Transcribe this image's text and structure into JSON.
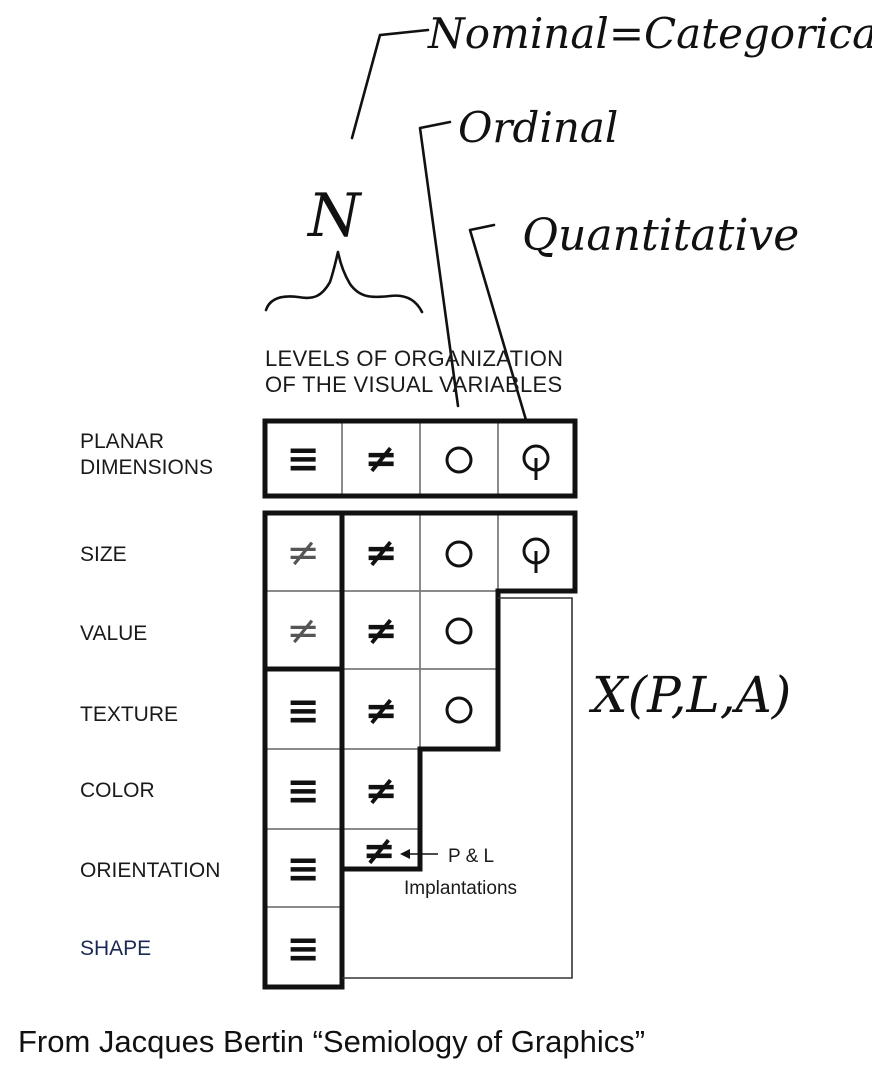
{
  "handwritten": {
    "nominal": "Nominal=Categorical",
    "ordinal": "Ordinal",
    "quantitative": "Quantitative",
    "n_mark": "N",
    "x_formula": "X(P,L,A)"
  },
  "heading": {
    "line1": "LEVELS OF ORGANIZATION",
    "line2": "OF THE VISUAL VARIABLES"
  },
  "symbols": {
    "associative": "≡",
    "selective": "≠",
    "ordered": "O",
    "quantitative": "Q"
  },
  "rows": [
    {
      "label_line1": "PLANAR",
      "label_line2": "DIMENSIONS",
      "cells": [
        "≡",
        "≠",
        "O",
        "Q"
      ]
    },
    {
      "label_line1": "SIZE",
      "cells": [
        "≠",
        "≠",
        "O",
        "Q"
      ]
    },
    {
      "label_line1": "VALUE",
      "cells": [
        "≠",
        "≠",
        "O"
      ]
    },
    {
      "label_line1": "TEXTURE",
      "cells": [
        "≡",
        "≠",
        "O"
      ]
    },
    {
      "label_line1": "COLOR",
      "cells": [
        "≡",
        "≠"
      ]
    },
    {
      "label_line1": "ORIENTATION",
      "cells": [
        "≡",
        "≠"
      ]
    },
    {
      "label_line1": "SHAPE",
      "cells": [
        "≡"
      ]
    }
  ],
  "annotation": {
    "line1": "P & L",
    "line2": "Implantations"
  },
  "caption": "From Jacques Bertin “Semiology of Graphics”"
}
